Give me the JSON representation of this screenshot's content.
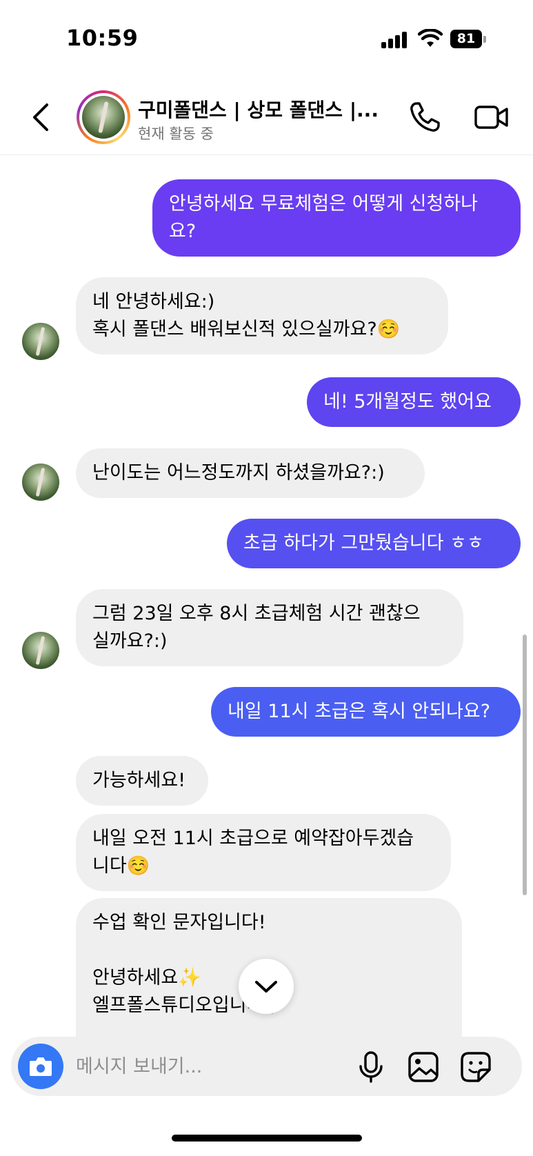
{
  "status": {
    "time": "10:59",
    "battery": "81"
  },
  "header": {
    "title": "구미폴댄스 | 상모 폴댄스 |...",
    "subtitle": "현재 활동 중"
  },
  "messages": [
    {
      "from": "me",
      "text": "안녕하세요 무료체험은 어떻게 신청하나\n요?"
    },
    {
      "from": "them",
      "text": "네 안녕하세요:)\n혹시 폴댄스 배워보신적 있으실까요?☺️"
    },
    {
      "from": "me",
      "text": "네! 5개월정도 했어요"
    },
    {
      "from": "them",
      "text": "난이도는 어느정도까지 하셨을까요?:)"
    },
    {
      "from": "me",
      "text": "초급 하다가 그만뒀습니다 ㅎㅎ"
    },
    {
      "from": "them",
      "text": "그럼 23일 오후 8시 초급체험 시간 괜찮으\n실까요?:)"
    },
    {
      "from": "me",
      "text": "내일 11시 초급은 혹시 안되나요?"
    },
    {
      "from": "them",
      "text": "가능하세요!"
    },
    {
      "from": "them",
      "text": "내일 오전 11시 초급으로 예약잡아두겠습\n니다☺️"
    },
    {
      "from": "them",
      "text": "수업 확인 문자입니다!\n\n안녕하세요✨\n엘프폴스튜디오입니다:)"
    }
  ],
  "composer": {
    "placeholder": "메시지 보내기..."
  },
  "colors": {
    "out_top": "#6a3df2",
    "out_mid": "#5b4cf0",
    "out_bottom": "#4a5ef2",
    "in_bubble": "#efefef",
    "camera": "#3478f6"
  },
  "icons": [
    "back-icon",
    "phone-icon",
    "video-icon",
    "chevron-down-icon",
    "camera-icon",
    "mic-icon",
    "gallery-icon",
    "sticker-icon"
  ]
}
